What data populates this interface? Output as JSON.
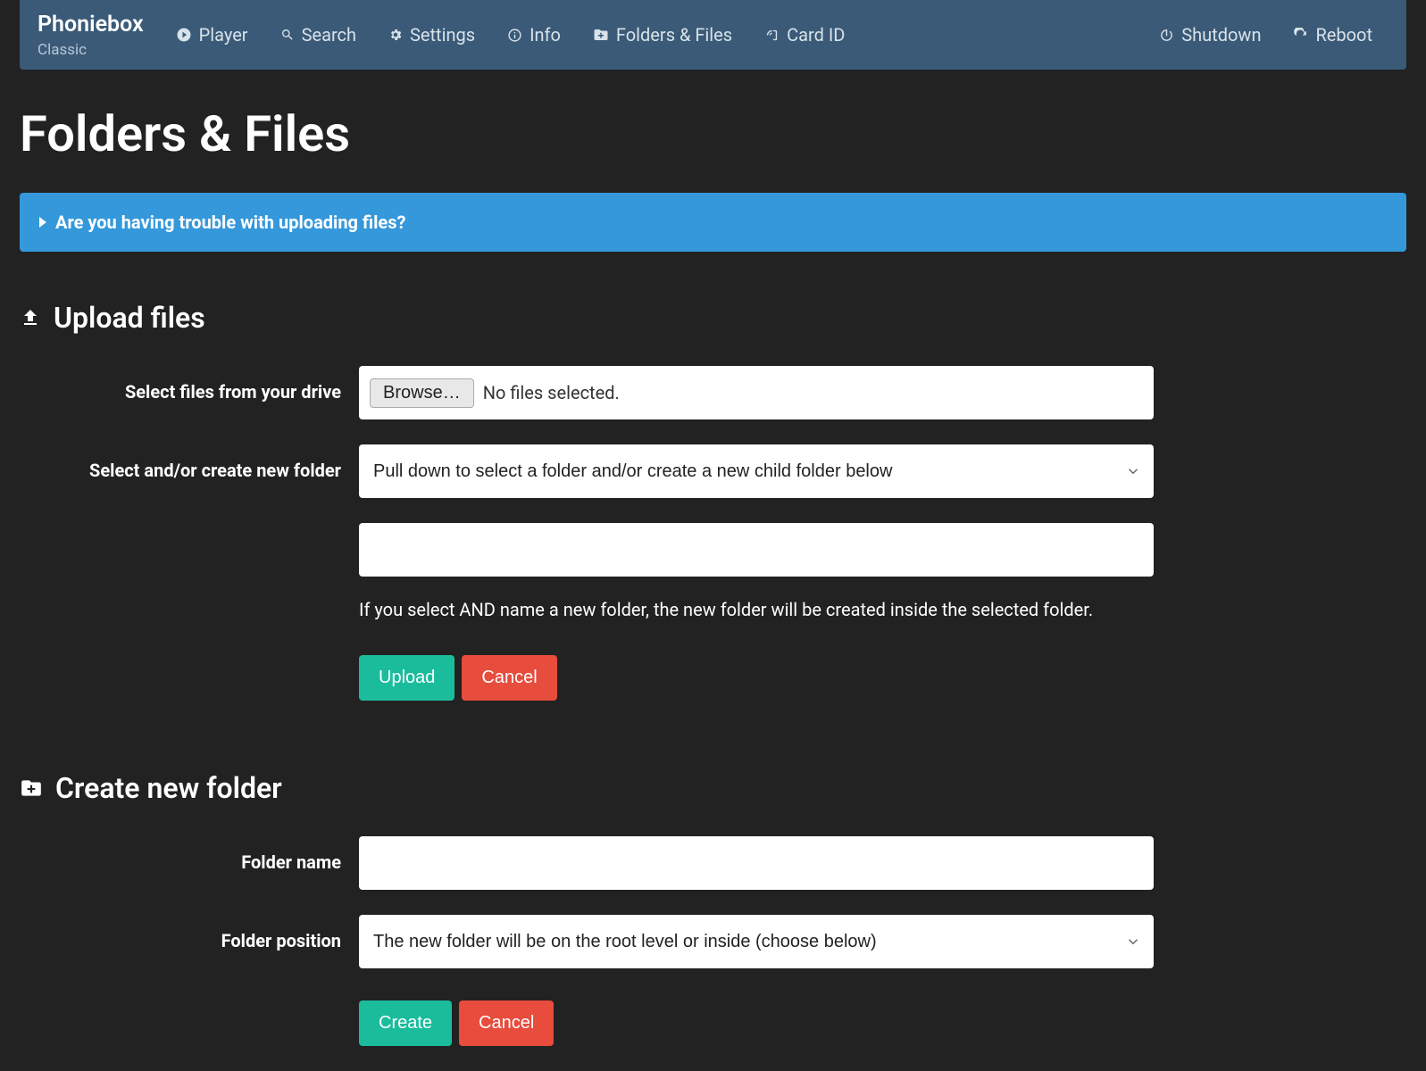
{
  "brand": {
    "title": "Phoniebox",
    "subtitle": "Classic"
  },
  "nav": {
    "player": "Player",
    "search": "Search",
    "settings": "Settings",
    "info": "Info",
    "folders": "Folders & Files",
    "cardid": "Card ID",
    "shutdown": "Shutdown",
    "reboot": "Reboot"
  },
  "page": {
    "title": "Folders & Files"
  },
  "info_panel": {
    "text": "Are you having trouble with uploading files?"
  },
  "upload": {
    "section_title": "Upload files",
    "select_files_label": "Select files from your drive",
    "browse_label": "Browse…",
    "file_status": "No files selected.",
    "select_folder_label": "Select and/or create new folder",
    "folder_select_placeholder": "Pull down to select a folder and/or create a new child folder below",
    "new_folder_value": "",
    "help_text": "If you select AND name a new folder, the new folder will be created inside the selected folder.",
    "upload_btn": "Upload",
    "cancel_btn": "Cancel"
  },
  "create": {
    "section_title": "Create new folder",
    "name_label": "Folder name",
    "name_value": "",
    "position_label": "Folder position",
    "position_select_placeholder": "The new folder will be on the root level or inside (choose below)",
    "create_btn": "Create",
    "cancel_btn": "Cancel"
  }
}
